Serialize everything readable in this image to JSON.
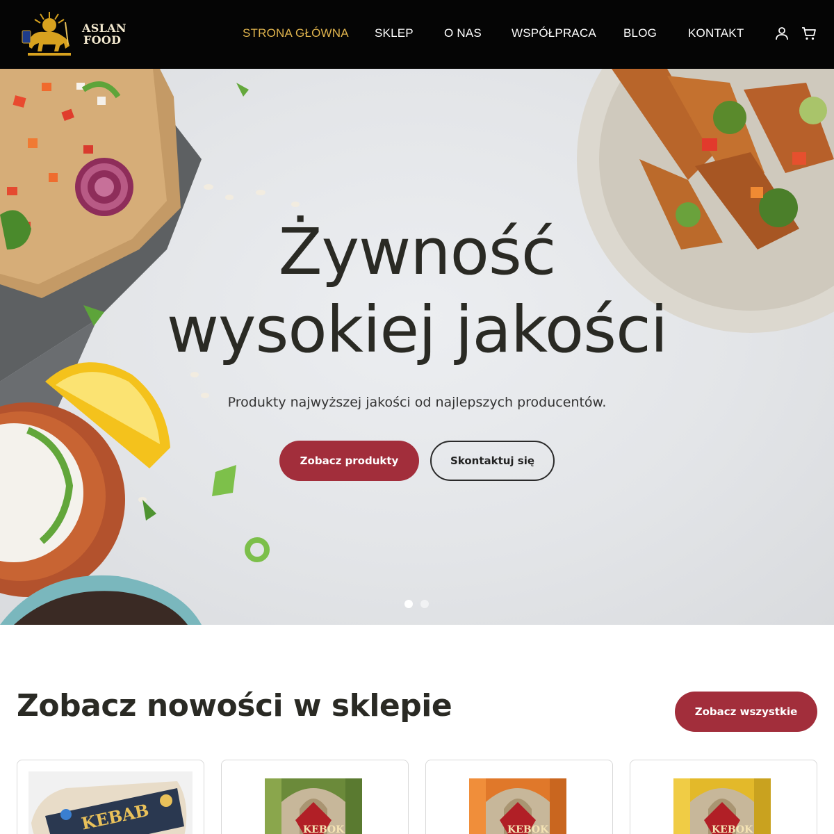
{
  "header": {
    "logo": {
      "line1": "ASLAN",
      "line2": "FOOD"
    },
    "nav": [
      {
        "label": "STRONA GŁÓWNA",
        "active": true
      },
      {
        "label": "SKLEP",
        "active": false
      },
      {
        "label": "O NAS",
        "active": false
      },
      {
        "label": "WSPÓŁPRACA",
        "active": false
      },
      {
        "label": "BLOG",
        "active": false
      },
      {
        "label": "KONTAKT",
        "active": false
      }
    ],
    "icons": [
      "user-icon",
      "cart-icon"
    ]
  },
  "hero": {
    "title_line1": "Żywność",
    "title_line2": "wysokiej jakości",
    "subtitle": "Produkty najwyższej jakości od najlepszych producentów.",
    "primary_button": "Zobacz produkty",
    "secondary_button": "Skontaktuj się",
    "slides": {
      "count": 2,
      "active": 1
    }
  },
  "new_products": {
    "title": "Zobacz nowości w sklepie",
    "see_all_button": "Zobacz wszystkie",
    "products": [
      {
        "label_text": "KEBAB"
      },
      {
        "label_text": "KEBOK"
      },
      {
        "label_text": "KEBOK"
      },
      {
        "label_text": "KEBOK"
      }
    ]
  },
  "colors": {
    "header_bg": "#050505",
    "nav_active": "#e1b54e",
    "accent": "#a22e3b",
    "logo_gold": "#d8a21f"
  }
}
